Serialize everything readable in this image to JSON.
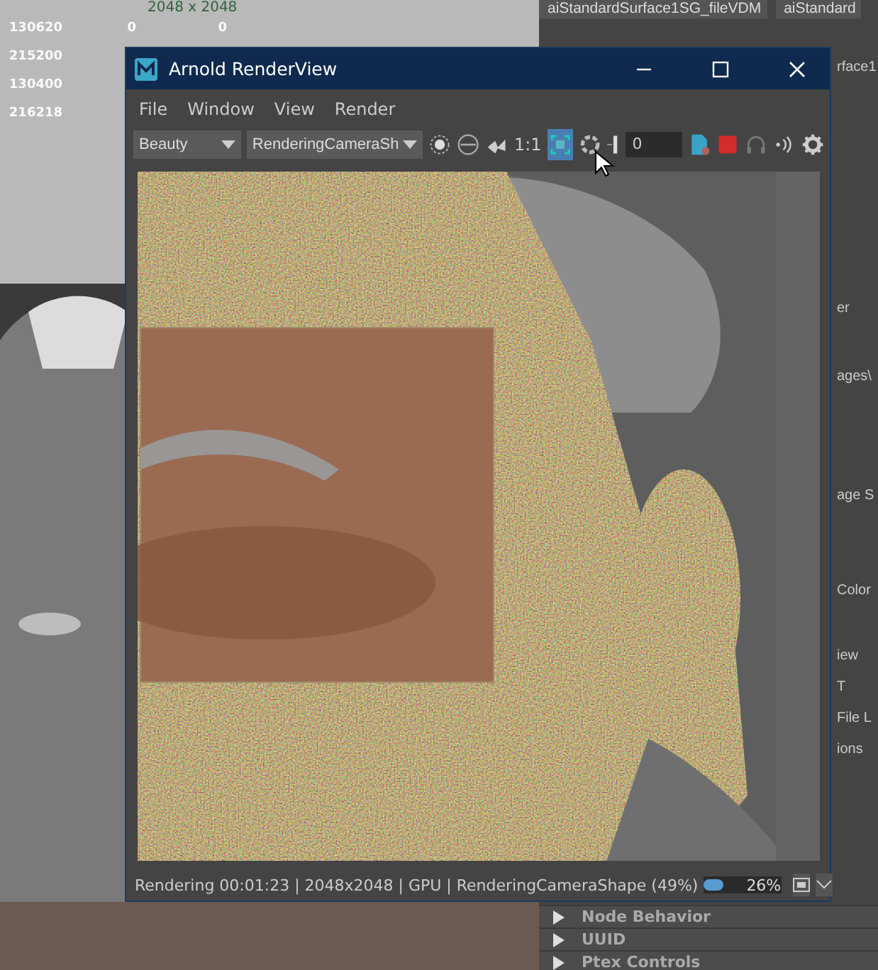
{
  "spreadsheet": {
    "size_label": "2048 x 2048",
    "rows": [
      {
        "column_1": "130620",
        "column_2": "0",
        "column_3": "0"
      },
      {
        "column_1": "215200"
      },
      {
        "column_1": "130400"
      },
      {
        "column_1": "216218"
      }
    ]
  },
  "attribute_editor": {
    "tabs": [
      "aiStandardSurface1SG_fileVDM",
      "aiStandard"
    ],
    "fragments": [
      "rface1",
      "er",
      "ages\\",
      "age S",
      "Color",
      "iew",
      "T",
      "File L",
      "ions"
    ],
    "sections": [
      {
        "label": "Node Behavior",
        "expanded": false
      },
      {
        "label": "UUID",
        "expanded": false
      },
      {
        "label": "Ptex Controls",
        "expanded": false
      }
    ]
  },
  "window": {
    "title": "Arnold RenderView",
    "menu": [
      "File",
      "Window",
      "View",
      "Render"
    ],
    "toolbar": {
      "aov": "Beauty",
      "camera": "RenderingCameraSh",
      "ratio": "1:1",
      "region": {
        "on": true
      },
      "exposure": "0"
    },
    "status": {
      "text": "Rendering 00:01:23 | 2048x2048 | GPU | RenderingCameraShape (49%)",
      "progress": {
        "level": 0.26,
        "reading": "26%"
      }
    }
  }
}
